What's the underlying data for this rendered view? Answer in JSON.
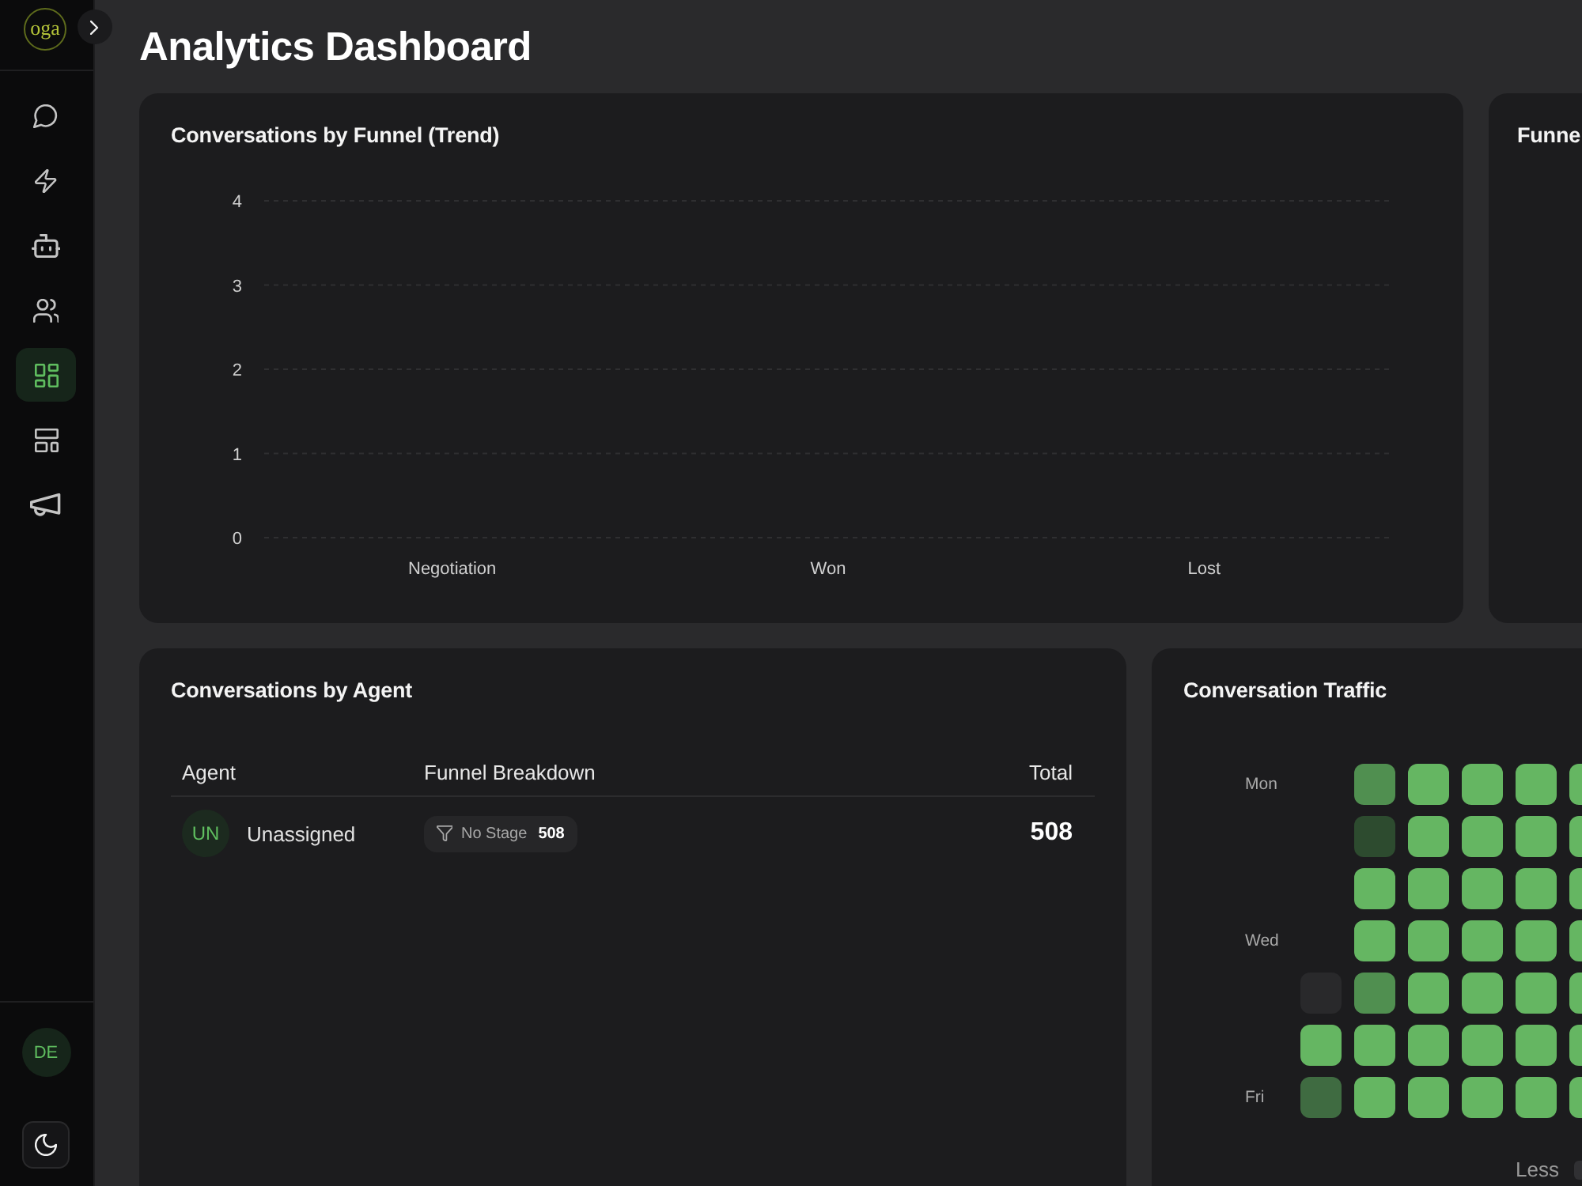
{
  "sidebar": {
    "logo": "oga",
    "nav": [
      {
        "selected": false
      },
      {
        "selected": false
      },
      {
        "selected": false
      },
      {
        "selected": false
      },
      {
        "selected": true
      },
      {
        "selected": false
      },
      {
        "selected": false
      }
    ],
    "user": {
      "initials": "DE"
    }
  },
  "page": {
    "title": "Analytics Dashboard"
  },
  "funnel_trend": {
    "title": "Conversations by Funnel (Trend)",
    "chart_data": {
      "type": "line",
      "categories": [
        "Negotiation",
        "Won",
        "Lost"
      ],
      "ylim": [
        0,
        4
      ],
      "yticks": [
        0,
        1,
        2,
        3,
        4
      ],
      "grid": true
    }
  },
  "funnel_card": {
    "title": "Funne"
  },
  "agents": {
    "title": "Conversations by Agent",
    "columns": [
      "Agent",
      "Funnel Breakdown",
      "Total"
    ],
    "rows": [
      {
        "initials": "UN",
        "name": "Unassigned",
        "stages": [
          {
            "label": "No Stage",
            "count": "508"
          }
        ],
        "total": "508"
      }
    ]
  },
  "traffic": {
    "title": "Conversation Traffic",
    "rows": [
      {
        "label": "Mon",
        "cells": [
          {
            "color": "#508f50"
          },
          {
            "color": "#65b662"
          },
          {
            "color": "#65b662"
          },
          {
            "color": "#65b662"
          },
          {
            "color": "#65b662"
          }
        ]
      },
      {
        "cells": [
          {
            "color": "#2d4b2f"
          },
          {
            "color": "#65b662"
          },
          {
            "color": "#65b662"
          },
          {
            "color": "#65b662"
          },
          {
            "color": "#65b662"
          }
        ]
      },
      {
        "cells": [
          {
            "color": "#65b662"
          },
          {
            "color": "#65b662"
          },
          {
            "color": "#65b662"
          },
          {
            "color": "#65b662"
          },
          {
            "color": "#65b662"
          }
        ]
      },
      {
        "label": "Wed",
        "cells": [
          {
            "color": "#65b662"
          },
          {
            "color": "#65b662"
          },
          {
            "color": "#65b662"
          },
          {
            "color": "#65b662"
          },
          {
            "color": "#65b662"
          }
        ]
      },
      {
        "cells": [
          {
            "color": "#29292b"
          },
          {
            "color": "#508f50"
          },
          {
            "color": "#65b662"
          },
          {
            "color": "#65b662"
          },
          {
            "color": "#65b662"
          },
          {
            "color": "#65b662"
          }
        ]
      },
      {
        "cells": [
          {
            "color": "#65b662"
          },
          {
            "color": "#65b662"
          },
          {
            "color": "#65b662"
          },
          {
            "color": "#65b662"
          },
          {
            "color": "#65b662"
          },
          {
            "color": "#65b662"
          }
        ]
      },
      {
        "label": "Fri",
        "cells": [
          {
            "color": "#3f6b41"
          },
          {
            "color": "#65b662"
          },
          {
            "color": "#65b662"
          },
          {
            "color": "#65b662"
          },
          {
            "color": "#65b662"
          },
          {
            "color": "#65b662"
          }
        ]
      }
    ],
    "legend": {
      "less": "Less",
      "swatches": [
        {
          "color": "#303033"
        }
      ]
    }
  }
}
